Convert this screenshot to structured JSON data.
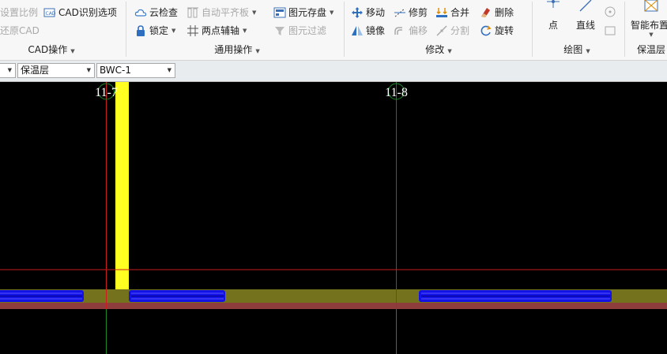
{
  "ribbon": {
    "cad_group": {
      "set_scale": "设置比例",
      "cad_options": "CAD识别选项",
      "restore_cad": "还原CAD",
      "label": "CAD操作"
    },
    "general_group": {
      "cloud_check": "云检查",
      "auto_align": "自动平齐板",
      "lock": "锁定",
      "two_point_axis": "两点辅轴",
      "element_save": "图元存盘",
      "element_filter": "图元过滤",
      "label": "通用操作"
    },
    "modify_group": {
      "move": "移动",
      "trim": "修剪",
      "merge": "合并",
      "delete": "删除",
      "mirror": "镜像",
      "offset": "偏移",
      "split": "分割",
      "rotate": "旋转",
      "label": "修改"
    },
    "draw_group": {
      "point": "点",
      "line": "直线",
      "label": "绘图"
    },
    "smart_group": {
      "smart_layout": "智能布置",
      "label": "保温层"
    }
  },
  "toolbar": {
    "layer_combo": "保温层",
    "element_combo": "BWC-1"
  },
  "canvas": {
    "axis_labels": [
      "11-7",
      "11-8"
    ]
  },
  "colors": {
    "background": "#000000",
    "insulation_column": "#ffff22",
    "insulation_strip": "#1212e6",
    "floor_slab": "#75721e",
    "floor_base": "#8e3c3c",
    "axis_red": "#c81e1e",
    "axis_green": "#1d8a2a"
  }
}
